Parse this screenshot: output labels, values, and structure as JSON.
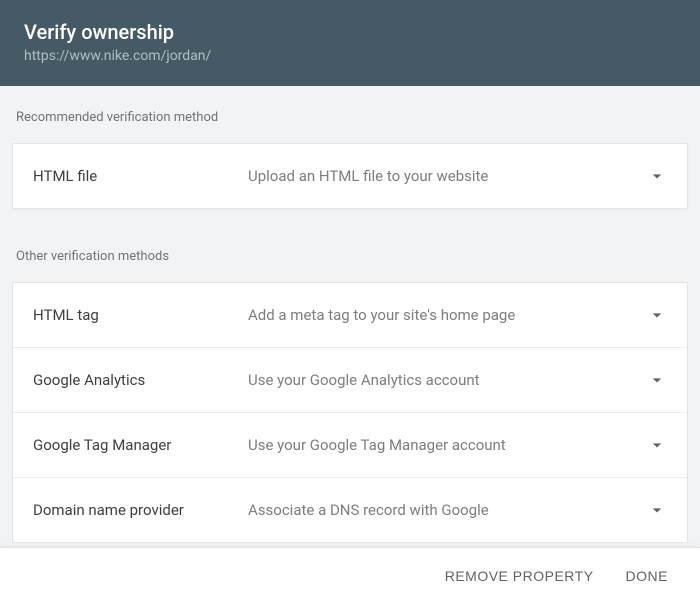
{
  "header": {
    "title": "Verify ownership",
    "url": "https://www.nike.com/jordan/"
  },
  "recommended": {
    "label": "Recommended verification method",
    "item": {
      "name": "HTML file",
      "desc": "Upload an HTML file to your website"
    }
  },
  "other": {
    "label": "Other verification methods",
    "items": [
      {
        "name": "HTML tag",
        "desc": "Add a meta tag to your site's home page"
      },
      {
        "name": "Google Analytics",
        "desc": "Use your Google Analytics account"
      },
      {
        "name": "Google Tag Manager",
        "desc": "Use your Google Tag Manager account"
      },
      {
        "name": "Domain name provider",
        "desc": "Associate a DNS record with Google"
      }
    ]
  },
  "footer": {
    "remove": "REMOVE PROPERTY",
    "done": "DONE"
  }
}
